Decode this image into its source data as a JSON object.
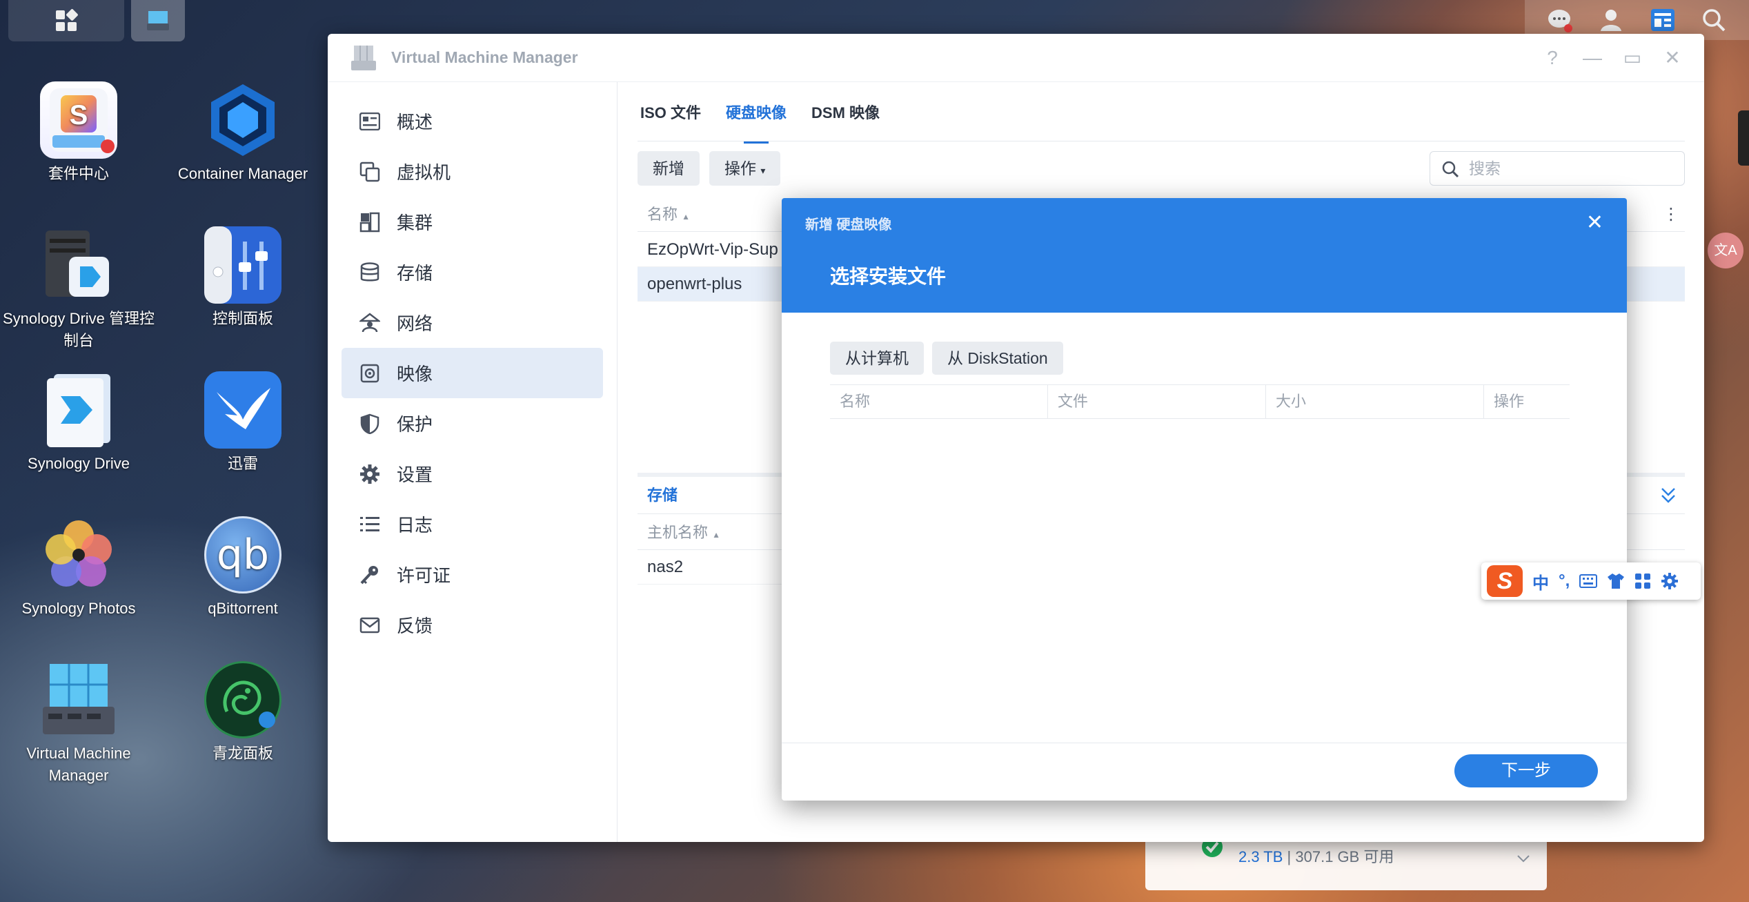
{
  "desktop": {
    "icons": [
      {
        "label": "套件中心"
      },
      {
        "label": "Container Manager"
      },
      {
        "label": "Synology Drive 管理控制台"
      },
      {
        "label": "控制面板"
      },
      {
        "label": "Synology Drive"
      },
      {
        "label": "迅雷"
      },
      {
        "label": "Synology Photos"
      },
      {
        "label": "qBittorrent"
      },
      {
        "label": "Virtual Machine Manager"
      },
      {
        "label": "青龙面板"
      }
    ],
    "qb_text": "qb"
  },
  "window": {
    "title": "Virtual Machine Manager",
    "controls": {
      "help": "?",
      "minimize": "—",
      "maximize": "▭",
      "close": "✕"
    }
  },
  "sidebar": {
    "items": [
      {
        "label": "概述",
        "icon": "overview-icon"
      },
      {
        "label": "虚拟机",
        "icon": "vm-icon"
      },
      {
        "label": "集群",
        "icon": "cluster-icon"
      },
      {
        "label": "存储",
        "icon": "storage-icon"
      },
      {
        "label": "网络",
        "icon": "network-icon"
      },
      {
        "label": "映像",
        "icon": "image-icon",
        "active": true
      },
      {
        "label": "保护",
        "icon": "shield-icon"
      },
      {
        "label": "设置",
        "icon": "gear-icon"
      },
      {
        "label": "日志",
        "icon": "log-icon"
      },
      {
        "label": "许可证",
        "icon": "key-icon"
      },
      {
        "label": "反馈",
        "icon": "mail-icon"
      }
    ]
  },
  "main": {
    "tabs": [
      {
        "label": "ISO 文件"
      },
      {
        "label": "硬盘映像",
        "active": true
      },
      {
        "label": "DSM 映像"
      }
    ],
    "toolbar": {
      "add": "新增",
      "action": "操作"
    },
    "search": {
      "placeholder": "搜索"
    },
    "table": {
      "header_name": "名称",
      "rows": [
        {
          "name": "EzOpWrt-Vip-Sup"
        },
        {
          "name": "openwrt-plus",
          "selected": true
        }
      ]
    },
    "storage_section": {
      "title": "存储",
      "header_host": "主机名称",
      "rows": [
        {
          "host": "nas2"
        }
      ]
    }
  },
  "modal": {
    "breadcrumb": "新增 硬盘映像",
    "heading": "选择安装文件",
    "close": "✕",
    "buttons": {
      "from_computer": "从计算机",
      "from_diskstation": "从 DiskStation"
    },
    "columns": [
      "名称",
      "文件",
      "大小",
      "操作"
    ],
    "next": "下一步"
  },
  "ime": {
    "lang": "中",
    "punct": "°,"
  },
  "storage_widget": {
    "used": "2.3 TB",
    "sep": "|",
    "free": "307.1 GB 可用"
  },
  "avatar_text": "文A",
  "colors": {
    "accent": "#2a80e4",
    "active_nav": "#e3ebf7"
  }
}
